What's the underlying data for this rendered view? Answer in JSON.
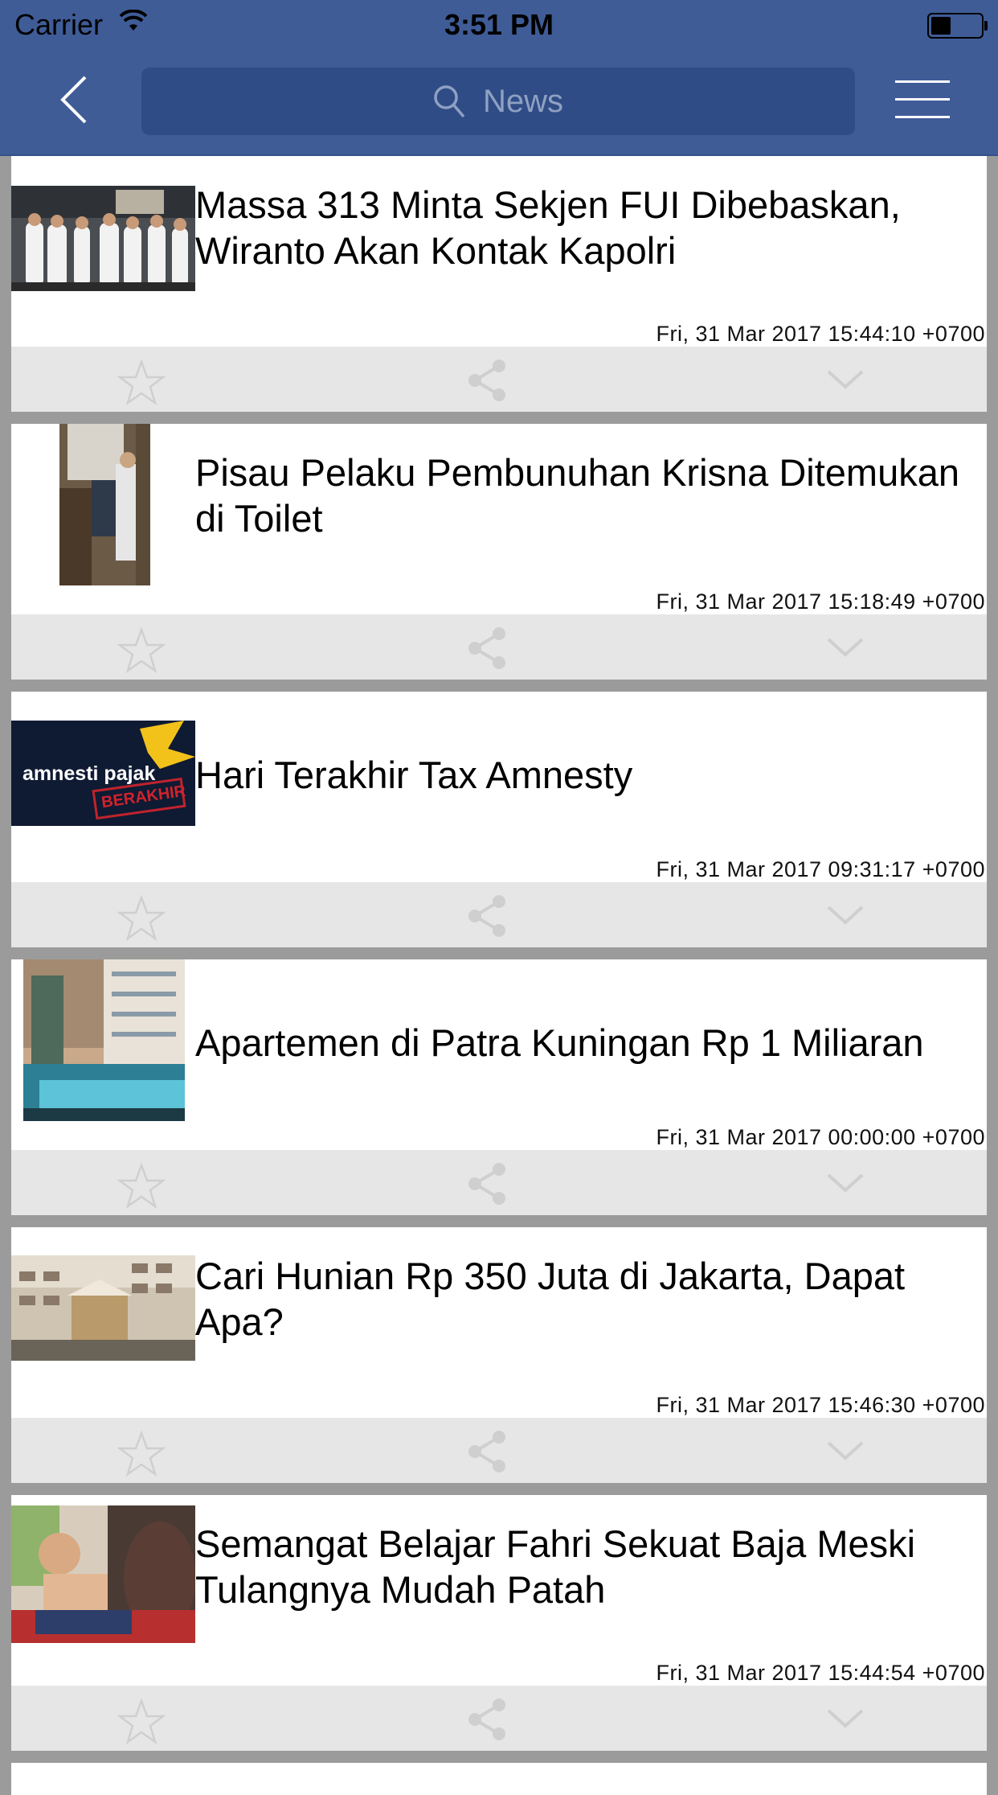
{
  "status_bar": {
    "carrier": "Carrier",
    "time": "3:51 PM"
  },
  "nav": {
    "search_placeholder": "News",
    "back_icon": "chevron-left-icon",
    "menu_icon": "hamburger-icon"
  },
  "colors": {
    "nav_bg": "#3f5c97",
    "search_bg": "#2f4c86",
    "list_bg": "#9b9b9b",
    "action_bar_bg": "#e6e6e6"
  },
  "articles": [
    {
      "title": "Massa 313 Minta Sekjen FUI Dibebaskan, Wiranto Akan Kontak Kapolri",
      "date": "Fri, 31 Mar 2017 15:44:10 +0700"
    },
    {
      "title": "Pisau Pelaku Pembunuhan Krisna Ditemukan di Toilet",
      "date": "Fri, 31 Mar 2017 15:18:49 +0700"
    },
    {
      "title": "Hari Terakhir Tax Amnesty",
      "date": "Fri, 31 Mar 2017 09:31:17 +0700",
      "thumb_text": "amnesti pajak",
      "thumb_stamp": "BERAKHIR"
    },
    {
      "title": "Apartemen di Patra Kuningan Rp 1 Miliaran",
      "date": "Fri, 31 Mar 2017 00:00:00 +0700"
    },
    {
      "title": "Cari Hunian Rp 350 Juta di Jakarta, Dapat Apa?",
      "date": "Fri, 31 Mar 2017 15:46:30 +0700"
    },
    {
      "title": "Semangat Belajar Fahri Sekuat Baja Meski Tulangnya Mudah Patah",
      "date": "Fri, 31 Mar 2017 15:44:54 +0700"
    }
  ],
  "actions": [
    "star-icon",
    "share-icon",
    "chevron-down-icon"
  ]
}
